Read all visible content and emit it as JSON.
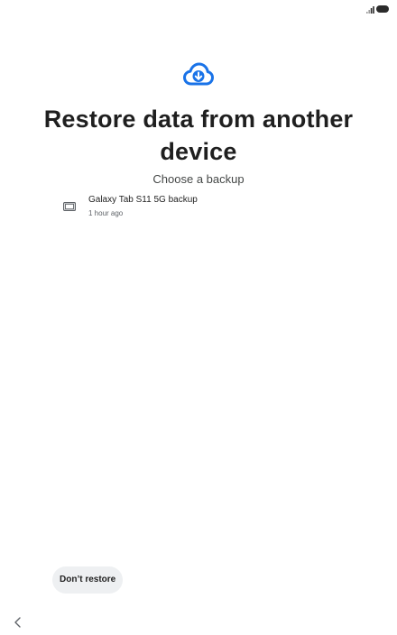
{
  "status_bar": {
    "icons": [
      "signal-icon",
      "battery-icon"
    ]
  },
  "header": {
    "icon": "cloud-download-icon",
    "icon_color": "#1a73e8",
    "title": "Restore data from another device",
    "subtitle": "Choose a backup"
  },
  "backups": [
    {
      "icon": "tablet-icon",
      "name": "Galaxy Tab S11 5G backup",
      "time": "1 hour ago"
    }
  ],
  "footer": {
    "dont_restore_label": "Don’t restore",
    "button_bg": "#eef0f2"
  },
  "navigation": {
    "back_icon": "back-chevron-icon"
  }
}
